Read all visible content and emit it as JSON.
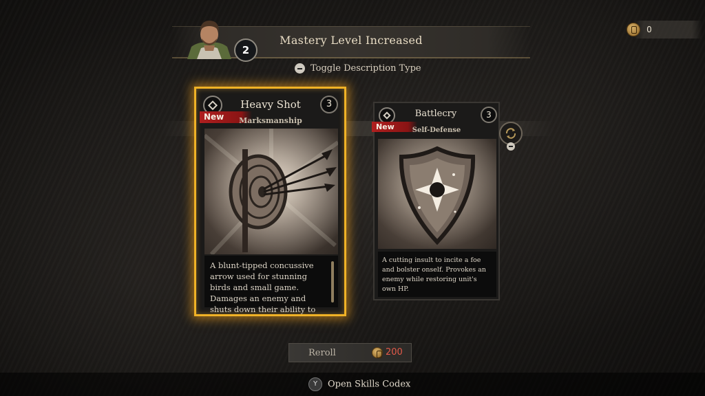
{
  "header": {
    "title": "Mastery Level Increased",
    "mastery_level": "2"
  },
  "currency": {
    "icon": "gold-coin-icon",
    "amount": "0"
  },
  "toggle": {
    "button_icon": "minus-button-icon",
    "label": "Toggle Description Type"
  },
  "cards": [
    {
      "title": "Heavy Shot",
      "cost": "3",
      "tag": "New",
      "category": "Marksmanship",
      "art_icon": "target-arrows-icon",
      "description": "A blunt-tipped concussive arrow used for stunning birds and small game. Damages an enemy and shuts down their ability to",
      "selected": true
    },
    {
      "title": "Battlecry",
      "cost": "3",
      "tag": "New",
      "category": "Self-Defense",
      "art_icon": "shield-star-icon",
      "description": "A cutting insult to incite a foe and bolster onself. Provokes an enemy while restoring unit's own HP.",
      "selected": false
    }
  ],
  "reroll": {
    "label": "Reroll",
    "cost": "200"
  },
  "footer": {
    "button_glyph": "Y",
    "label": "Open Skills Codex"
  },
  "colors": {
    "selected_glow": "#f0b226",
    "new_tag": "#b01f1f",
    "reroll_cost": "#e35a4a"
  }
}
